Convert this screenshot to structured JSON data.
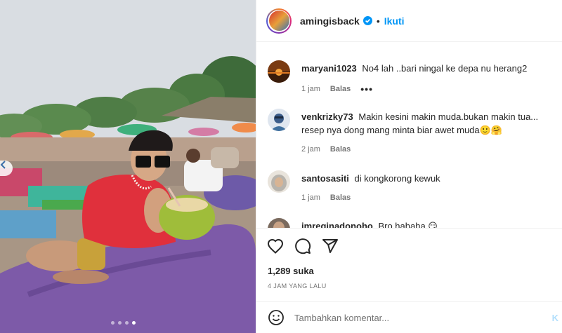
{
  "post": {
    "username": "amingisback",
    "separator": "•",
    "follow_label": "Ikuti"
  },
  "photo": {
    "carousel_dots": 4,
    "active_dot": 3
  },
  "comments": [
    {
      "username": "maryani1023",
      "text": "No4 lah ..bari ningal ke depa nu herang2",
      "time": "1 jam",
      "reply_label": "Balas",
      "more": "•••"
    },
    {
      "username": "venkrizky73",
      "text": "Makin kesini makin muda.bukan makin tua... resep nya dong mang minta biar awet muda🙂🤗",
      "time": "2 jam",
      "reply_label": "Balas"
    },
    {
      "username": "santosasiti",
      "text": "di kongkorong kewuk",
      "time": "1 jam",
      "reply_label": "Balas"
    },
    {
      "username": "imreginadonoho",
      "text": "Bro hahaha 😏",
      "time": "",
      "reply_label": ""
    }
  ],
  "actions": {
    "likes": "1,289 suka",
    "posted_time": "4 JAM YANG LALU"
  },
  "add_comment": {
    "placeholder": "Tambahkan komentar...",
    "post_label": "K"
  },
  "icons": [
    "chevron-left-icon",
    "verified-badge-icon",
    "more-options-icon",
    "heart-icon",
    "comment-icon",
    "share-icon",
    "emoji-icon"
  ],
  "colors": {
    "accent": "#0095f6",
    "verified": "#0095f6",
    "muted": "#737373",
    "divider": "#efefef"
  }
}
